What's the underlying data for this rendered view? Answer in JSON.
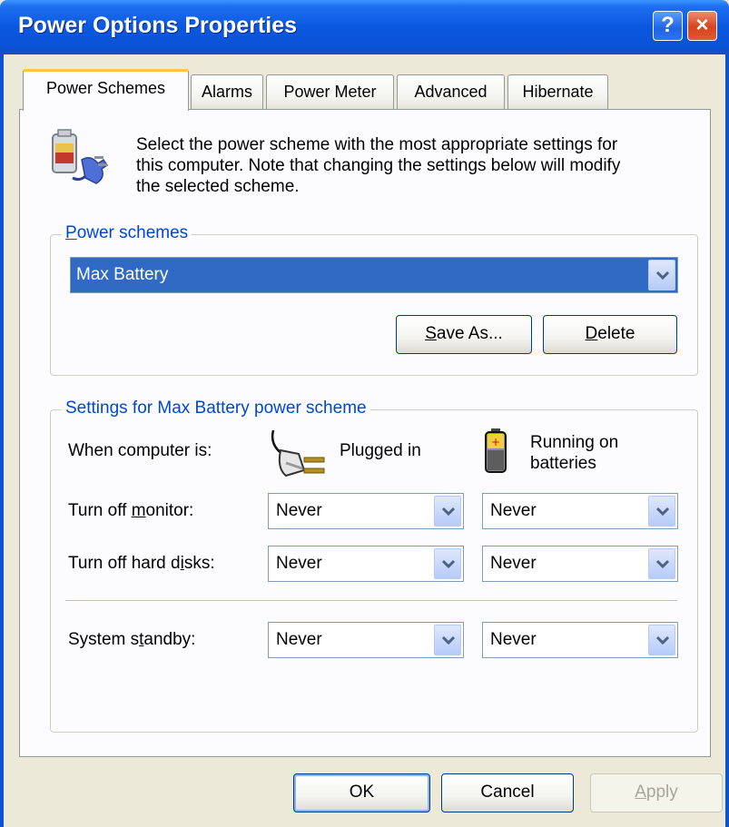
{
  "window": {
    "title": "Power Options Properties",
    "help_label": "?",
    "close_label": "×"
  },
  "tabs": [
    {
      "label": "Power Schemes",
      "active": true
    },
    {
      "label": "Alarms",
      "active": false
    },
    {
      "label": "Power Meter",
      "active": false
    },
    {
      "label": "Advanced",
      "active": false
    },
    {
      "label": "Hibernate",
      "active": false
    }
  ],
  "intro": {
    "line1": "Select the power scheme with the most appropriate settings for",
    "line2": "this computer. Note that changing the settings below will modify",
    "line3": "the selected scheme."
  },
  "power_schemes": {
    "group_label": "Power schemes",
    "selected": "Max Battery",
    "save_as_label": "Save As...",
    "delete_label": "Delete"
  },
  "settings": {
    "group_label": "Settings for Max Battery power scheme",
    "when_label": "When computer is:",
    "plugged_in_label": "Plugged in",
    "running_on_label_1": "Running on",
    "running_on_label_2": "batteries",
    "rows": [
      {
        "label": "Turn off monitor:",
        "plugged": "Never",
        "battery": "Never"
      },
      {
        "label": "Turn off hard disks:",
        "plugged": "Never",
        "battery": "Never"
      },
      {
        "label": "System standby:",
        "plugged": "Never",
        "battery": "Never"
      }
    ]
  },
  "footer": {
    "ok_label": "OK",
    "cancel_label": "Cancel",
    "apply_label": "Apply"
  },
  "colors": {
    "titlebar": "#0a52d6",
    "selection": "#316ac5",
    "group_label": "#0046d5",
    "active_tab_accent": "#ffc83c"
  }
}
